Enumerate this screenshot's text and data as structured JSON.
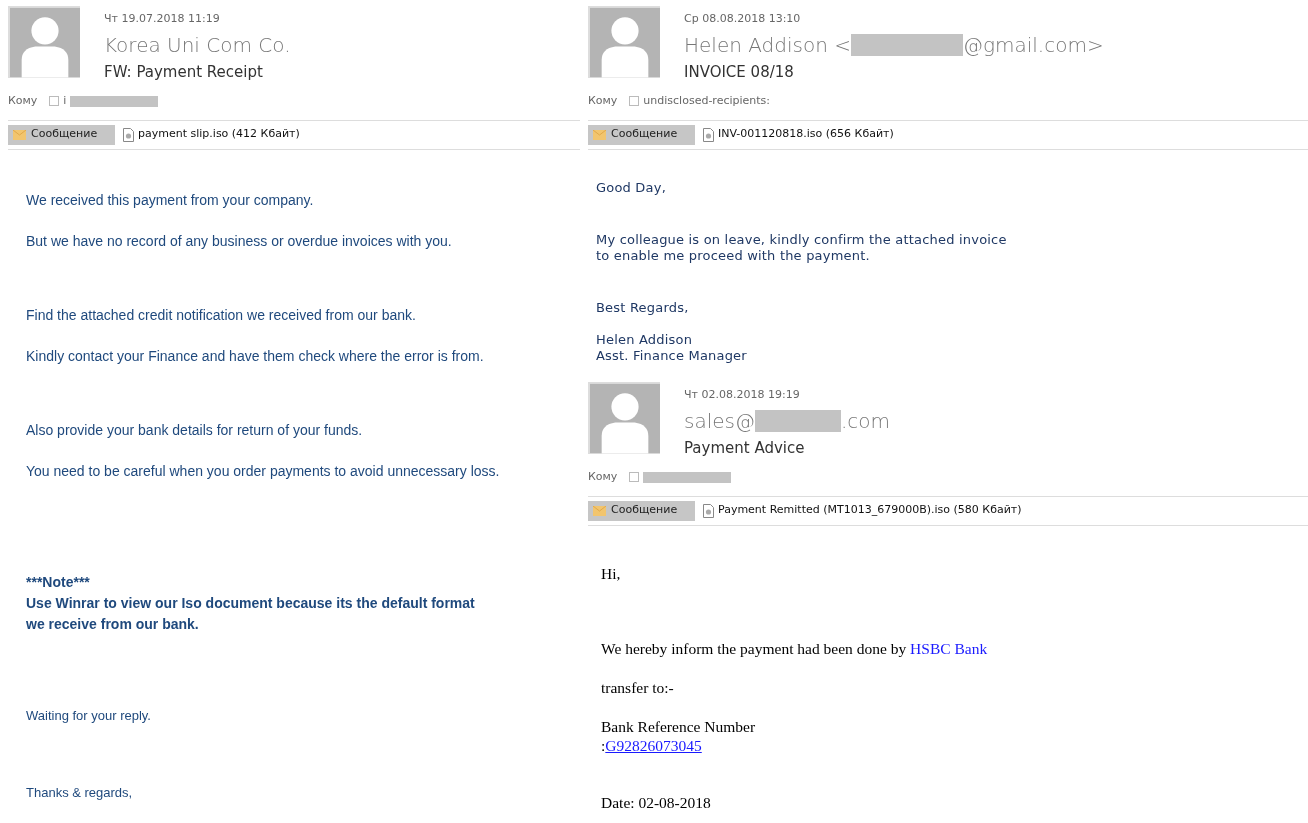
{
  "emails": [
    {
      "date": "Чт 19.07.2018 11:19",
      "sender": [
        {
          "kind": "text",
          "text": "Korea Uni Com Co."
        }
      ],
      "subject": "FW: Payment Receipt",
      "to_label": "Кому",
      "recipients": [
        {
          "kind": "text",
          "text": "i"
        },
        {
          "kind": "redacted"
        }
      ],
      "message_tab": "Сообщение",
      "attachment": "payment slip.iso (412 Кбайт)",
      "body": [
        {
          "kind": "paragraphs",
          "lines": [
            [
              {
                "kind": "text",
                "text": "We received this payment from your company."
              }
            ],
            [
              {
                "kind": "text",
                "text": "But we have no record of any business or overdue invoices with you."
              }
            ]
          ]
        },
        {
          "kind": "paragraphs",
          "lines": [
            [
              {
                "kind": "text",
                "text": "Find the attached credit notification we received from our bank."
              }
            ],
            [
              {
                "kind": "text",
                "text": "Kindly contact your Finance and  have them check where the error is from."
              }
            ]
          ]
        },
        {
          "kind": "paragraphs",
          "lines": [
            [
              {
                "kind": "text",
                "text": "Also provide your bank details for return of your funds."
              }
            ],
            [
              {
                "kind": "text",
                "text": "You need to be careful when you order payments to avoid unnecessary loss."
              }
            ]
          ]
        },
        {
          "kind": "block",
          "lines": [
            [
              {
                "kind": "bold",
                "text": "***Note***"
              }
            ],
            [
              {
                "kind": "bold",
                "text": "Use Winrar to view our Iso document because its the default format"
              }
            ],
            [
              {
                "kind": "bold",
                "text": "we receive from our bank."
              }
            ]
          ]
        },
        {
          "kind": "block",
          "lines": [
            [
              {
                "kind": "small",
                "text": "Waiting for your reply."
              }
            ]
          ]
        },
        {
          "kind": "block",
          "lines": [
            [
              {
                "kind": "small",
                "text": "Thanks & regards,"
              }
            ]
          ]
        }
      ]
    },
    {
      "date": "Ср 08.08.2018 13:10",
      "sender": [
        {
          "kind": "text",
          "text": "Helen Addison <"
        },
        {
          "kind": "redacted"
        },
        {
          "kind": "text",
          "text": "@gmail.com>"
        }
      ],
      "subject": "INVOICE 08/18",
      "to_label": "Кому",
      "recipients": [
        {
          "kind": "text",
          "text": "undisclosed-recipients:"
        }
      ],
      "message_tab": "Сообщение",
      "attachment": "INV-001120818.iso (656 Кбайт)",
      "body": [
        {
          "kind": "block",
          "lines": [
            [
              {
                "kind": "text",
                "text": "Good Day,"
              }
            ]
          ]
        },
        {
          "kind": "block",
          "lines": [
            [
              {
                "kind": "text",
                "text": "My colleague is on leave, kindly confirm the attached invoice"
              }
            ],
            [
              {
                "kind": "text",
                "text": "to enable me proceed with the payment."
              }
            ]
          ]
        },
        {
          "kind": "block",
          "lines": [
            [
              {
                "kind": "text",
                "text": "Best Regards,"
              }
            ]
          ]
        },
        {
          "kind": "block",
          "lines": [
            [
              {
                "kind": "text",
                "text": "Helen Addison"
              }
            ],
            [
              {
                "kind": "text",
                "text": "Asst. Finance Manager"
              }
            ]
          ]
        }
      ]
    },
    {
      "date": "Чт 02.08.2018 19:19",
      "sender": [
        {
          "kind": "text",
          "text": "sales@"
        },
        {
          "kind": "redacted"
        },
        {
          "kind": "text",
          "text": ".com"
        }
      ],
      "subject": "Payment Advice",
      "to_label": "Кому",
      "recipients": [
        {
          "kind": "redacted"
        }
      ],
      "message_tab": "Сообщение",
      "attachment": "Payment Remitted (MT1013_679000B).iso (580 Кбайт)",
      "body": [
        {
          "kind": "block",
          "lines": [
            [
              {
                "kind": "text",
                "text": "Hi,"
              }
            ]
          ]
        },
        {
          "kind": "paragraphs",
          "lines": [
            [
              {
                "kind": "text",
                "text": "We hereby inform the payment had been done by "
              },
              {
                "kind": "highlight",
                "text": "HSBC Bank"
              }
            ],
            [
              {
                "kind": "text",
                "text": "transfer to:-"
              }
            ]
          ]
        },
        {
          "kind": "block",
          "lines": [
            [
              {
                "kind": "text",
                "text": "Bank Reference Number"
              }
            ],
            [
              {
                "kind": "text",
                "text": ":"
              },
              {
                "kind": "link",
                "text": "G92826073045"
              }
            ]
          ]
        },
        {
          "kind": "block",
          "lines": [
            [
              {
                "kind": "text",
                "text": "Date: 02-08-2018"
              }
            ]
          ]
        }
      ]
    }
  ]
}
